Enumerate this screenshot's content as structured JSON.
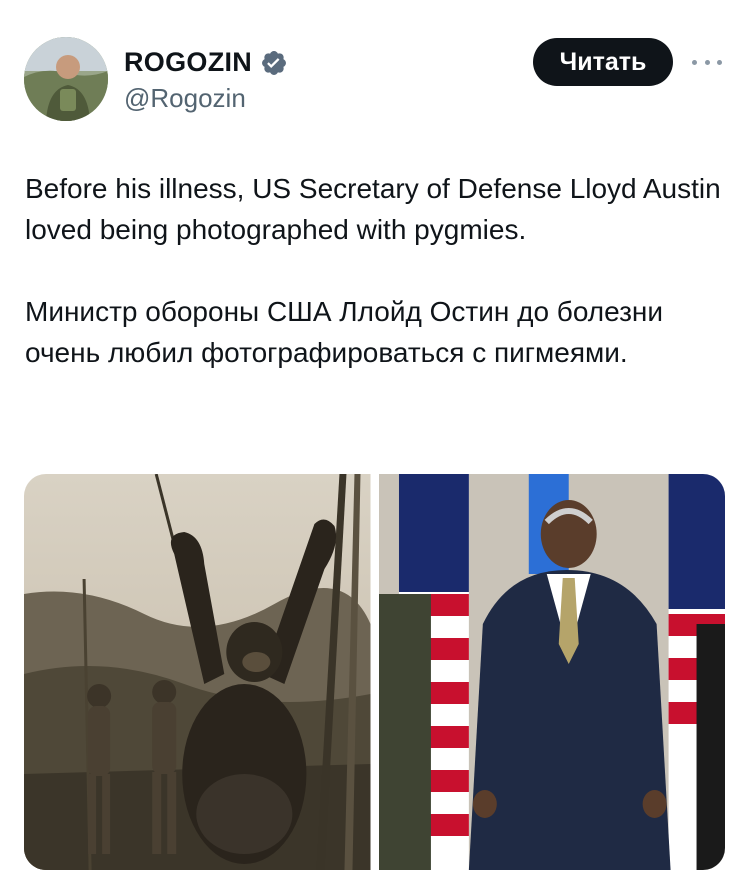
{
  "post": {
    "author": {
      "display_name": "ROGOZIN",
      "handle": "@Rogozin",
      "verified": true,
      "avatar_icon": "avatar-photo"
    },
    "follow_label": "Читать",
    "more_icon": "more-horizontal-icon",
    "text": {
      "english": "Before his illness, US Secretary of Defense Lloyd Austin loved being photographed with pygmies.",
      "russian": "Министр обороны США Ллойд Остин до болезни очень любил фотографироваться с пигмеями."
    },
    "media": [
      {
        "kind": "photo",
        "icon": "sepia-photo-gorilla"
      },
      {
        "kind": "photo",
        "icon": "photo-man-in-suit-with-flags"
      }
    ]
  },
  "colors": {
    "text": "#0f1419",
    "secondary": "#536471",
    "verified": "#1d9bf0",
    "button_bg": "#0f1419",
    "button_text": "#ffffff"
  }
}
